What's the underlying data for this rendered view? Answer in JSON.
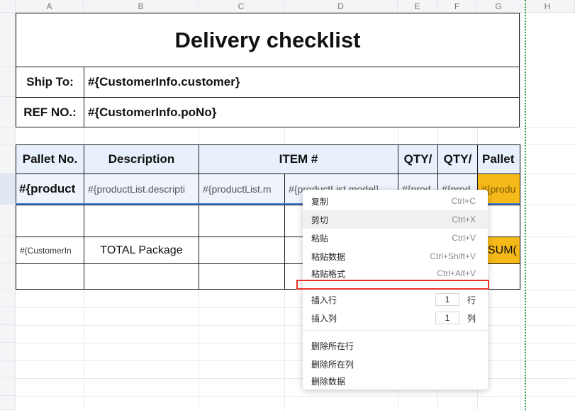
{
  "columns": [
    "A",
    "B",
    "C",
    "D",
    "E",
    "F",
    "G",
    "H"
  ],
  "sheet": {
    "title": "Delivery checklist",
    "ship_to_label": "Ship To:",
    "ship_to_value": "#{CustomerInfo.customer}",
    "ref_label": "REF NO.:",
    "ref_value": "#{CustomerInfo.poNo}",
    "headers": [
      "Pallet No.",
      "Description",
      "ITEM #",
      "QTY/",
      "QTY/",
      "Pallet"
    ],
    "row_placeholders": [
      "#{product",
      "#{productList.descripti",
      "#{productList.m",
      "#{productList.model}",
      "#{prod",
      "#{prod",
      "#{produ"
    ],
    "total_left": "#{CustomerIn",
    "total_label": "TOTAL  Package",
    "total_right": "SUM("
  },
  "context_menu": {
    "items": [
      {
        "label": "复制",
        "shortcut": "Ctrl+C"
      },
      {
        "label": "剪切",
        "shortcut": "Ctrl+X"
      },
      {
        "label": "粘贴",
        "shortcut": "Ctrl+V"
      },
      {
        "label": "粘贴数据",
        "shortcut": "Ctrl+Shift+V"
      },
      {
        "label": "粘贴格式",
        "shortcut": "Ctrl+Alt+V"
      }
    ],
    "insert_row": {
      "label": "插入行",
      "value": "1",
      "unit": "行"
    },
    "insert_col": {
      "label": "插入列",
      "value": "1",
      "unit": "列"
    },
    "delete_items": [
      "删除所在行",
      "删除所在列",
      "删除数据"
    ]
  }
}
